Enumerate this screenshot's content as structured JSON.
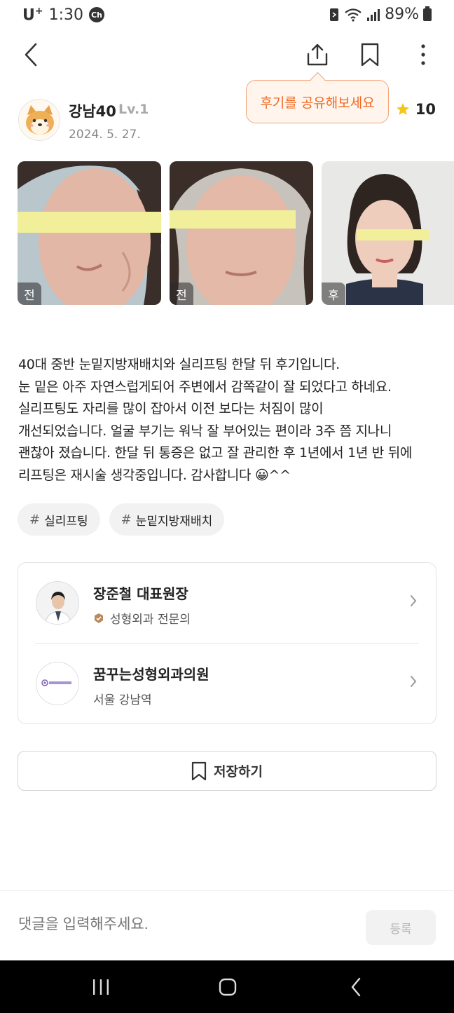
{
  "status_bar": {
    "carrier": "U",
    "carrier_sup": "+",
    "time": "1:30",
    "chat_badge": "Ch",
    "battery": "89%"
  },
  "nav": {
    "back_icon": "back-arrow-icon",
    "share_icon": "share-icon",
    "bookmark_icon": "bookmark-icon",
    "more_icon": "more-vertical-icon"
  },
  "tooltip": {
    "text": "후기를 공유해보세요"
  },
  "author": {
    "name": "강남40",
    "level": "Lv.1",
    "date": "2024. 5. 27."
  },
  "rating": {
    "value": "10",
    "star_color": "#f5c518"
  },
  "photos": [
    {
      "badge": "전"
    },
    {
      "badge": "전"
    },
    {
      "badge": "후"
    }
  ],
  "review": {
    "text": "40대 중반 눈밑지방재배치와 실리프팅 한달 뒤 후기입니다.\n눈 밑은 아주 자연스럽게되어 주변에서 감쪽같이 잘 되었다고 하네요.\n실리프팅도 자리를 많이 잡아서 이전 보다는 처짐이 많이\n개선되었습니다. 얼굴 부기는 워낙 잘 부어있는 편이라 3주 쯤 지나니\n괜찮아 졌습니다. 한달 뒤 통증은 없고 잘 관리한 후 1년에서 1년 반 뒤에\n리프팅은 재시술 생각중입니다. 감사합니다 😀^^"
  },
  "tags": [
    {
      "hash": "#",
      "label": "실리프팅"
    },
    {
      "hash": "#",
      "label": "눈밑지방재배치"
    }
  ],
  "doctor": {
    "name": "장준철 대표원장",
    "specialty": "성형외과 전문의"
  },
  "clinic": {
    "name": "꿈꾸는성형외과의원",
    "location": "서울 강남역"
  },
  "save_button": {
    "label": "저장하기"
  },
  "comment": {
    "placeholder": "댓글을 입력해주세요.",
    "submit_label": "등록"
  },
  "colors": {
    "accent_orange": "#f06a24",
    "tooltip_bg": "#fff5ec"
  }
}
